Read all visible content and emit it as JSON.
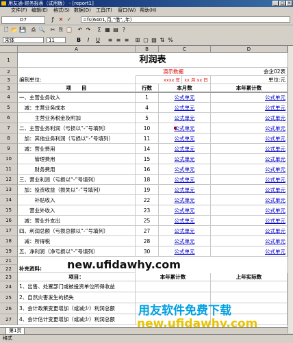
{
  "window": {
    "title": "用友通-财务报表（试用版） - [report1]"
  },
  "menu": [
    "文件(F)",
    "编辑(E)",
    "格式(S)",
    "数据(D)",
    "工具(T)",
    "窗口(W)",
    "帮助(H)"
  ],
  "formula_bar": {
    "cell_ref": "D7",
    "formula": "=fs(6401,月,\"借\",,年)"
  },
  "toolbar2": {
    "font": "宋体",
    "size": "11",
    "bold": "B",
    "italic": "I",
    "underline": "U"
  },
  "columns": [
    "A",
    "B",
    "C",
    "D"
  ],
  "report": {
    "title": "利润表",
    "demo": "演示数据",
    "form_no": "会企02表",
    "unit_label": "单位:元",
    "company_label": "编制单位:",
    "date_year": "xxxx 年",
    "date_md": "xx 月 xx 日",
    "headers": [
      "项　　目",
      "行数",
      "本月数",
      "本年累计数"
    ],
    "formula_unit": "公式单元",
    "rows": [
      {
        "n": "4",
        "item": "一、主营业务收入",
        "line": "1"
      },
      {
        "n": "5",
        "item": "　减：主营业务成本",
        "line": "4"
      },
      {
        "n": "6",
        "item": "　　　主营业务税金及附加",
        "line": "5"
      },
      {
        "n": "7",
        "item": "二、主营业务利润（亏损以“-”号填列）",
        "line": "10"
      },
      {
        "n": "8",
        "item": "　加：其他业务利润（亏损以“-”号填列）",
        "line": "11"
      },
      {
        "n": "9",
        "item": "　减：营业费用",
        "line": "14"
      },
      {
        "n": "10",
        "item": "　　　管理费用",
        "line": "15"
      },
      {
        "n": "11",
        "item": "　　　财务费用",
        "line": "16"
      },
      {
        "n": "12",
        "item": "三、营业利润（亏损以“-”号填列）",
        "line": "18"
      },
      {
        "n": "13",
        "item": "　加：投资收益（损失以“-”号填列）",
        "line": "19"
      },
      {
        "n": "14",
        "item": "　　　补贴收入",
        "line": "22"
      },
      {
        "n": "15",
        "item": "　　营业外收入",
        "line": "23"
      },
      {
        "n": "16",
        "item": "　减：营业外支出",
        "line": "25"
      },
      {
        "n": "17",
        "item": "四、利润总额（亏损总额以“-”号填列）",
        "line": "27"
      },
      {
        "n": "18",
        "item": "　减：所得税",
        "line": "28"
      },
      {
        "n": "19",
        "item": "五、净利润（净亏损以“-”号填列）",
        "line": "30"
      }
    ],
    "supplement": "补充资料:",
    "supp_headers": [
      "项目：",
      "本年累计数",
      "上年实际数"
    ],
    "supp_rows": [
      {
        "n": "24",
        "item": "1、出售、处置部门或被投资单位所得收益"
      },
      {
        "n": "25",
        "item": "2、自然灾害发生的损失"
      },
      {
        "n": "26",
        "item": "3、会计政策变更增加（或减少）利润总额"
      },
      {
        "n": "27",
        "item": "4、会计估计变更增加（或减少）利润总额"
      }
    ]
  },
  "sheet_tab": "第1页",
  "status": "格式",
  "watermarks": {
    "url1": "new.ufidawhy.com",
    "cn": "用友软件免费下载",
    "url2": "new.ufidawhy.com"
  }
}
